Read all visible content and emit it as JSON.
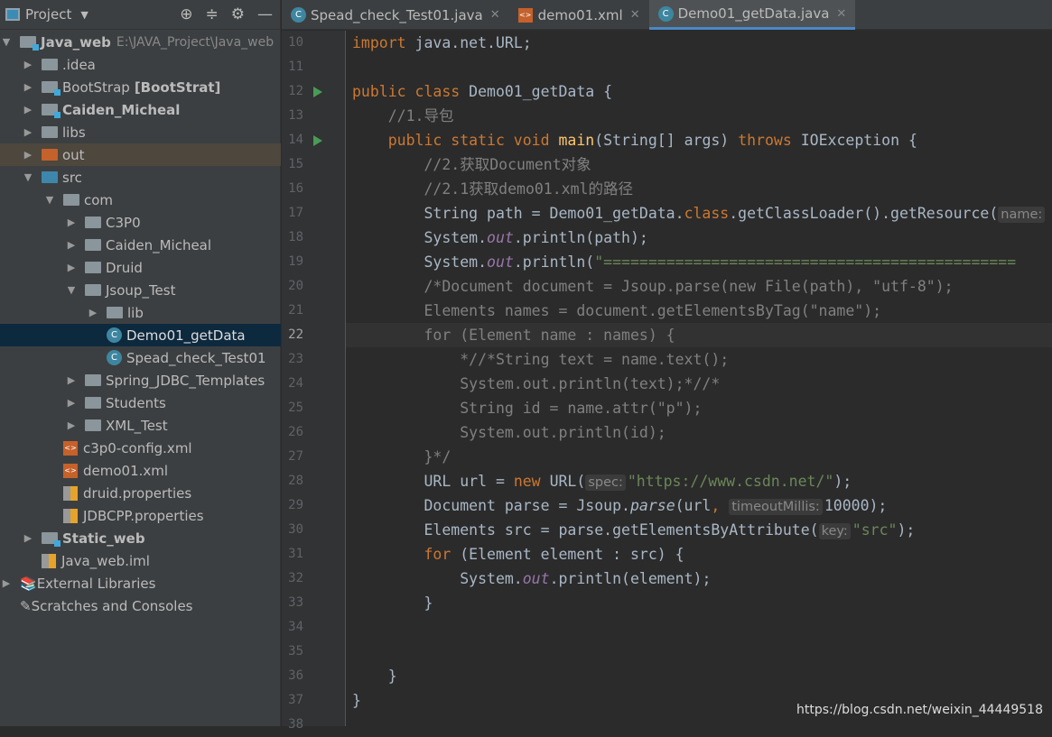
{
  "sidebar": {
    "title": "Project",
    "tools": [
      "locate-icon",
      "collapse-icon",
      "gear-icon",
      "minimize-icon"
    ],
    "items": [
      {
        "label": "Java_web",
        "extra": "E:\\JAVA_Project\\Java_web",
        "level": 0,
        "arrow": "down",
        "icon": "module",
        "bold": true
      },
      {
        "label": ".idea",
        "level": 1,
        "arrow": "right",
        "icon": "folder"
      },
      {
        "label": "BootStrap",
        "extra_bold": "[BootStrat]",
        "level": 1,
        "arrow": "right",
        "icon": "module"
      },
      {
        "label": "Caiden_Micheal",
        "level": 1,
        "arrow": "right",
        "icon": "module",
        "bold": true
      },
      {
        "label": "libs",
        "level": 1,
        "arrow": "right",
        "icon": "folder"
      },
      {
        "label": "out",
        "level": 1,
        "arrow": "right",
        "icon": "folder-orange",
        "state": "out"
      },
      {
        "label": "src",
        "level": 1,
        "arrow": "down",
        "icon": "folder-blue"
      },
      {
        "label": "com",
        "level": 2,
        "arrow": "down",
        "icon": "package"
      },
      {
        "label": "C3P0",
        "level": 3,
        "arrow": "right",
        "icon": "package"
      },
      {
        "label": "Caiden_Micheal",
        "level": 3,
        "arrow": "right",
        "icon": "package"
      },
      {
        "label": "Druid",
        "level": 3,
        "arrow": "right",
        "icon": "package"
      },
      {
        "label": "Jsoup_Test",
        "level": 3,
        "arrow": "down",
        "icon": "package"
      },
      {
        "label": "lib",
        "level": 4,
        "arrow": "right",
        "icon": "package"
      },
      {
        "label": "Demo01_getData",
        "level": 4,
        "icon": "class",
        "state": "selected"
      },
      {
        "label": "Spead_check_Test01",
        "level": 4,
        "icon": "class"
      },
      {
        "label": "Spring_JDBC_Templates",
        "level": 3,
        "arrow": "right",
        "icon": "package"
      },
      {
        "label": "Students",
        "level": 3,
        "arrow": "right",
        "icon": "package"
      },
      {
        "label": "XML_Test",
        "level": 3,
        "arrow": "right",
        "icon": "package"
      },
      {
        "label": "c3p0-config.xml",
        "level": 2,
        "icon": "xml"
      },
      {
        "label": "demo01.xml",
        "level": 2,
        "icon": "xml"
      },
      {
        "label": "druid.properties",
        "level": 2,
        "icon": "properties"
      },
      {
        "label": "JDBCPP.properties",
        "level": 2,
        "icon": "properties"
      },
      {
        "label": "Static_web",
        "level": 1,
        "arrow": "right",
        "icon": "module",
        "bold": true
      },
      {
        "label": "Java_web.iml",
        "level": 1,
        "icon": "iml"
      },
      {
        "label": "External Libraries",
        "level": 0,
        "arrow": "right",
        "icon": "libraries"
      },
      {
        "label": "Scratches and Consoles",
        "level": 0,
        "icon": "scratches"
      }
    ]
  },
  "tabs": [
    {
      "label": "Spead_check_Test01.java",
      "icon": "class"
    },
    {
      "label": "demo01.xml",
      "icon": "xml"
    },
    {
      "label": "Demo01_getData.java",
      "icon": "class",
      "active": true
    }
  ],
  "editor": {
    "first_line": 10,
    "current_line": 22,
    "run_lines": [
      12,
      14
    ],
    "lines": [
      [
        [
          "kw",
          "import "
        ],
        [
          "pl",
          "java.net.URL;"
        ]
      ],
      [],
      [
        [
          "kw",
          "public class "
        ],
        [
          "pl",
          "Demo01_getData {"
        ]
      ],
      [
        [
          "cm",
          "    //1.导包"
        ]
      ],
      [
        [
          "kw",
          "    public static void "
        ],
        [
          "fn",
          "main"
        ],
        [
          "pl",
          "(String[] args) "
        ],
        [
          "kw",
          "throws "
        ],
        [
          "pl",
          "IOException {"
        ]
      ],
      [
        [
          "cm",
          "        //2.获取Document对象"
        ]
      ],
      [
        [
          "cm",
          "        //2.1获取demo01.xml的路径"
        ]
      ],
      [
        [
          "pl",
          "        String path = Demo01_getData."
        ],
        [
          "kw",
          "class"
        ],
        [
          "pl",
          ".getClassLoader().getResource("
        ],
        [
          "hint",
          "name:"
        ]
      ],
      [
        [
          "pl",
          "        System."
        ],
        [
          "it",
          "out"
        ],
        [
          "pl",
          ".println(path);"
        ]
      ],
      [
        [
          "pl",
          "        System."
        ],
        [
          "it",
          "out"
        ],
        [
          "pl",
          ".println("
        ],
        [
          "str",
          "\"=============================================="
        ]
      ],
      [
        [
          "cm",
          "        /*Document document = Jsoup.parse(new File(path), \"utf-8\");"
        ]
      ],
      [
        [
          "cm",
          "        Elements names = document.getElementsByTag(\"name\");"
        ]
      ],
      [
        [
          "cm",
          "        for (Element name : names) {"
        ]
      ],
      [
        [
          "cm",
          "            *//*String text = name.text();"
        ]
      ],
      [
        [
          "cm",
          "            System.out.println(text);*//*"
        ]
      ],
      [
        [
          "cm",
          "            String id = name.attr(\"p\");"
        ]
      ],
      [
        [
          "cm",
          "            System.out.println(id);"
        ]
      ],
      [
        [
          "cm",
          "        }*/"
        ]
      ],
      [
        [
          "pl",
          "        URL url = "
        ],
        [
          "kw",
          "new "
        ],
        [
          "pl",
          "URL("
        ],
        [
          "hint",
          "spec:"
        ],
        [
          "str",
          "\"https://www.csdn.net/\""
        ],
        [
          "pl",
          ");"
        ]
      ],
      [
        [
          "pl",
          "        Document parse = Jsoup."
        ],
        [
          "itf",
          "parse"
        ],
        [
          "pl",
          "(url"
        ],
        [
          "kw",
          ", "
        ],
        [
          "hint",
          "timeoutMillis:"
        ],
        [
          "str",
          ""
        ],
        [
          "pl",
          "10000);"
        ]
      ],
      [
        [
          "pl",
          "        Elements src = parse.getElementsByAttribute("
        ],
        [
          "hint",
          "key:"
        ],
        [
          "str",
          "\"src\""
        ],
        [
          "pl",
          ");"
        ]
      ],
      [
        [
          "kw",
          "        for "
        ],
        [
          "pl",
          "(Element element : src) {"
        ]
      ],
      [
        [
          "pl",
          "            System."
        ],
        [
          "it",
          "out"
        ],
        [
          "pl",
          ".println(element);"
        ]
      ],
      [
        [
          "pl",
          "        }"
        ]
      ],
      [],
      [],
      [
        [
          "pl",
          "    }"
        ]
      ],
      [
        [
          "pl",
          "}"
        ]
      ],
      []
    ]
  },
  "watermark": "https://blog.csdn.net/weixin_44449518"
}
